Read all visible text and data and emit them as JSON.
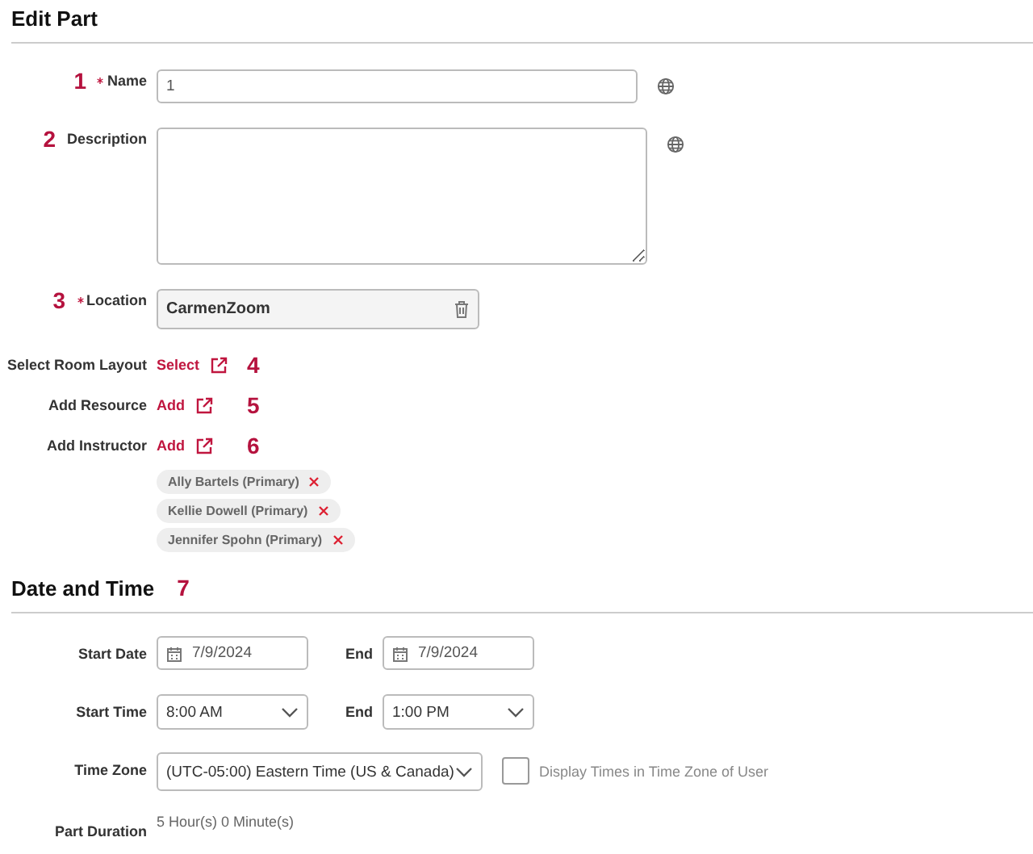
{
  "sections": [
    {
      "title": "Edit Part",
      "fields": [
        {
          "kind": "text",
          "label": "Name",
          "required": true,
          "marker": "1",
          "value": "1",
          "translatable": true
        },
        {
          "kind": "textarea",
          "label": "Description",
          "required": false,
          "marker": "2",
          "translatable": true
        },
        {
          "kind": "lookup",
          "label": "Location",
          "required": true,
          "marker": "3",
          "value": "CarmenZoom"
        },
        {
          "kind": "link",
          "label": "Select Room Layout",
          "required": false,
          "link": "Select",
          "marker": "4"
        },
        {
          "kind": "link",
          "label": "Add Resource",
          "required": false,
          "link": "Add",
          "marker": "5"
        },
        {
          "kind": "link",
          "label": "Add Instructor",
          "required": false,
          "link": "Add",
          "marker": "6",
          "chips": [
            "Ally Bartels (Primary)",
            "Kellie Dowell (Primary)",
            "Jennifer Spohn (Primary)"
          ]
        }
      ]
    },
    {
      "title": "Date and Time",
      "marker": "7",
      "fields": [
        {
          "kind": "date",
          "label": "Start Date",
          "required": false,
          "value": "7/9/2024",
          "end_label": "End",
          "end_value": "7/9/2024"
        },
        {
          "kind": "time",
          "label": "Start Time",
          "required": false,
          "value": "8:00 AM",
          "end_label": "End",
          "end_value": "1:00 PM"
        },
        {
          "kind": "select",
          "label": "Time Zone",
          "required": false,
          "value": "(UTC-05:00) Eastern Time (US & Canada)",
          "checkbox": {
            "label": "Display Times in Time Zone of User",
            "checked": false
          }
        },
        {
          "kind": "readonly",
          "label": "Part Duration",
          "required": false,
          "value": "5 Hour(s) 0 Minute(s)"
        }
      ]
    }
  ]
}
